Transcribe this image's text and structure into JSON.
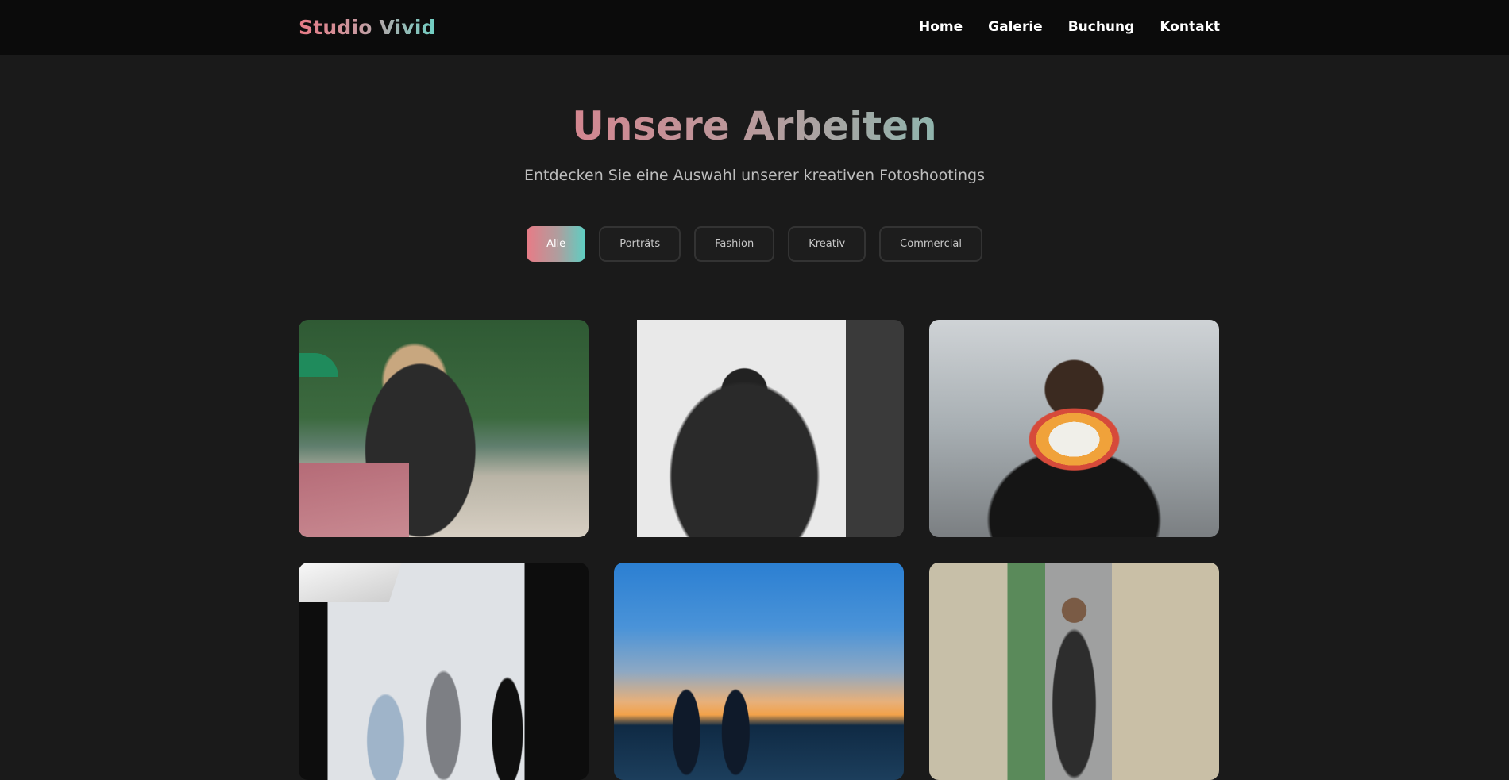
{
  "brand": {
    "name": "Studio Vivid"
  },
  "nav": {
    "items": [
      {
        "label": "Home"
      },
      {
        "label": "Galerie"
      },
      {
        "label": "Buchung"
      },
      {
        "label": "Kontakt"
      }
    ]
  },
  "hero": {
    "title": "Unsere Arbeiten",
    "subtitle": "Entdecken Sie eine Auswahl unserer kreativen Fotoshootings"
  },
  "filters": {
    "items": [
      {
        "label": "Alle",
        "active": true
      },
      {
        "label": "Porträts",
        "active": false
      },
      {
        "label": "Fashion",
        "active": false
      },
      {
        "label": "Kreativ",
        "active": false
      },
      {
        "label": "Commercial",
        "active": false
      }
    ]
  },
  "gallery": {
    "items": [
      {
        "name": "gallery-photo-woman-beach"
      },
      {
        "name": "gallery-photo-man-studio-bw"
      },
      {
        "name": "gallery-photo-flowers-portrait"
      },
      {
        "name": "gallery-photo-studio-fashion-shoot"
      },
      {
        "name": "gallery-photo-couple-sunset"
      },
      {
        "name": "gallery-photo-man-stone-arch"
      }
    ]
  },
  "colors": {
    "background": "#1a1a1a",
    "navbar": "#0b0b0b",
    "accent_pink": "#e87b86",
    "accent_teal": "#5dcfc3"
  }
}
